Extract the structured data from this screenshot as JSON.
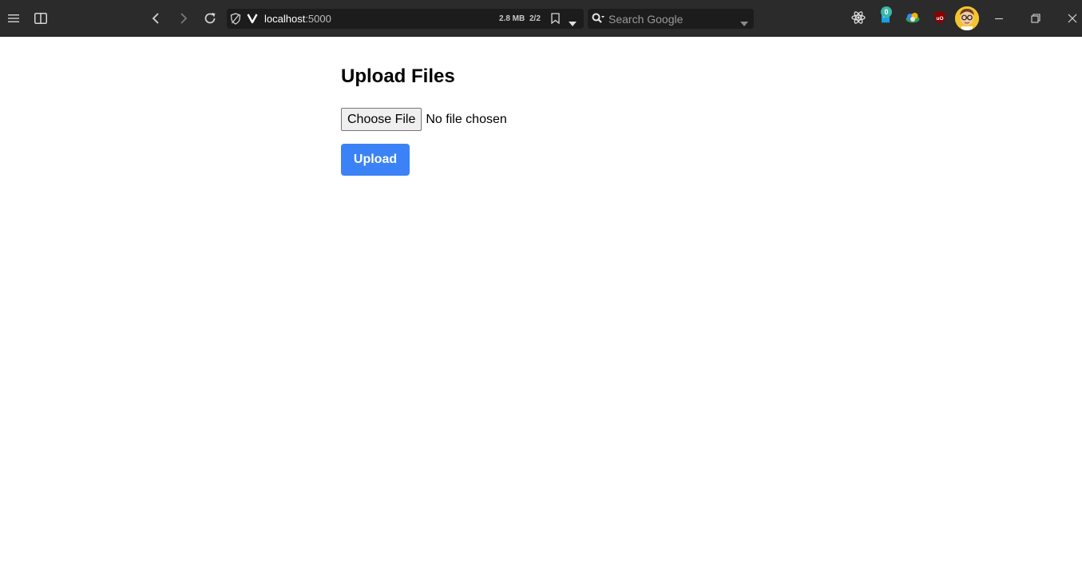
{
  "browser": {
    "address": {
      "host": "localhost",
      "port": ":5000"
    },
    "page_size": "2.8 MB",
    "tab_count": "2/2",
    "search_placeholder": "Search Google",
    "extension_badge": "0"
  },
  "page": {
    "title": "Upload Files",
    "choose_file_label": "Choose File",
    "file_status": "No file chosen",
    "upload_label": "Upload"
  },
  "colors": {
    "upload_button": "#3b82f6",
    "toolbar_bg": "#2b2b2b"
  }
}
